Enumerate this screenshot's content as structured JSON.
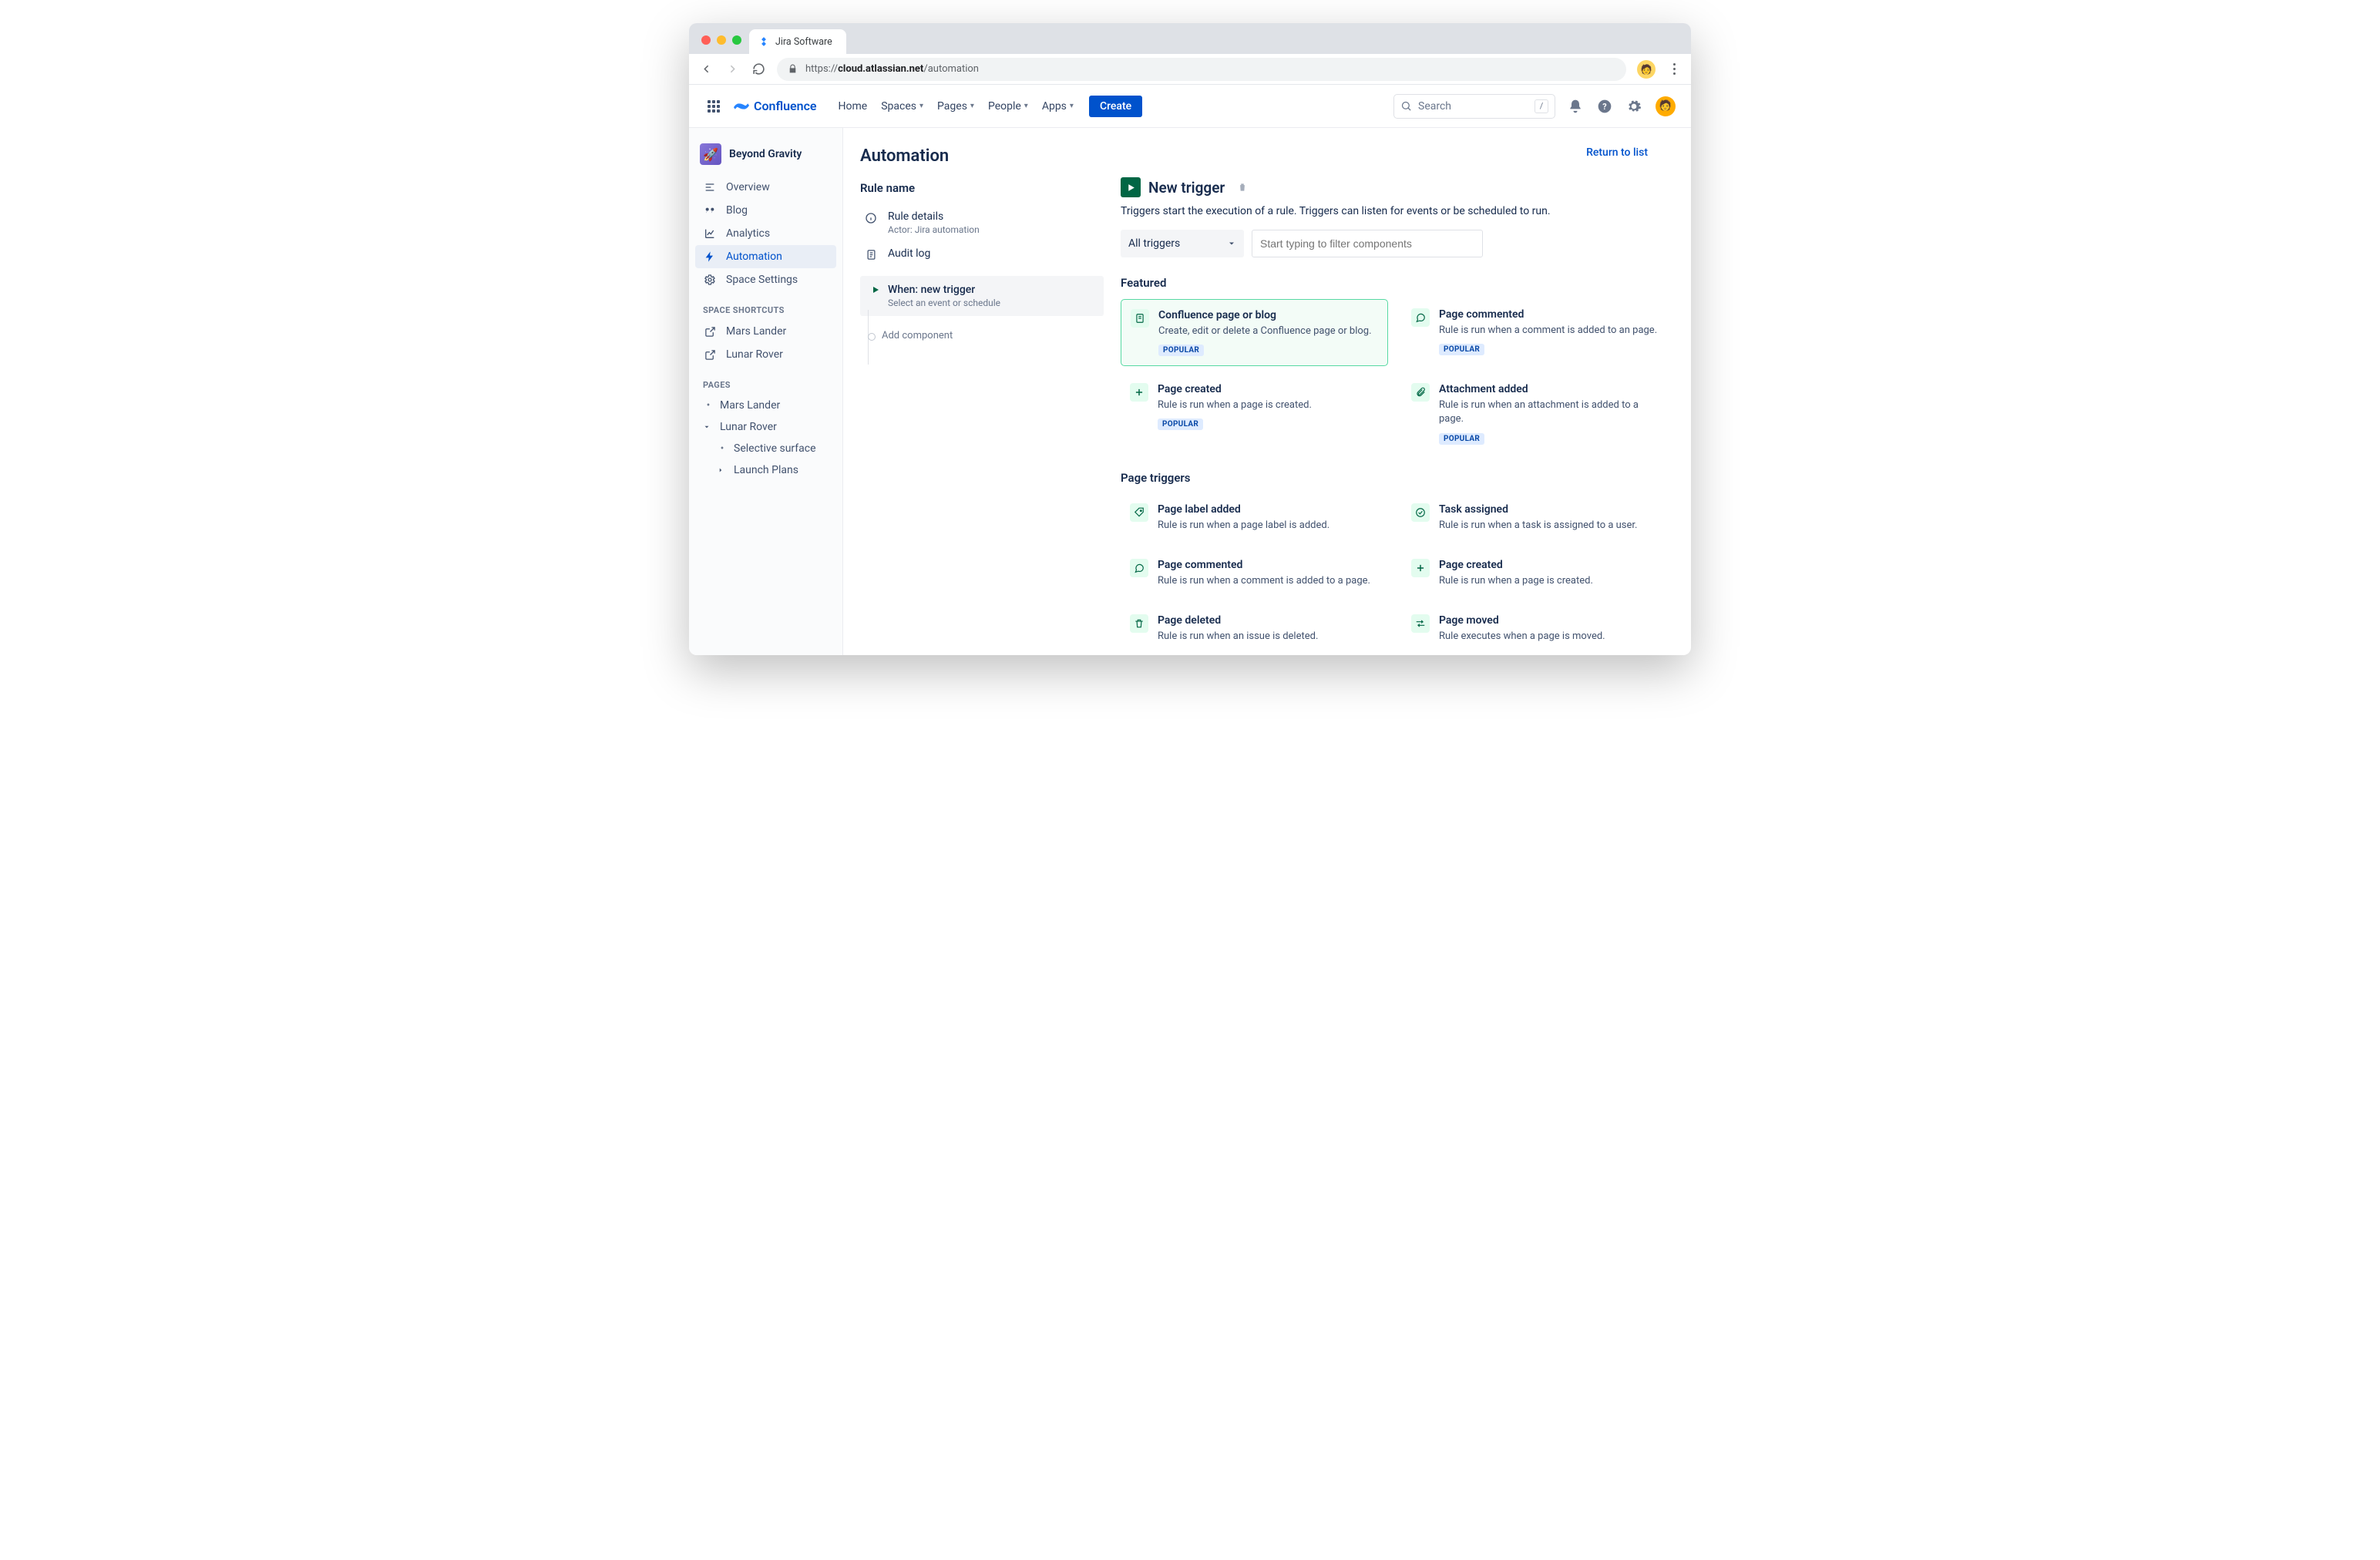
{
  "browser": {
    "tab_title": "Jira Software",
    "url_prefix": "https://",
    "url_host": "cloud.atlassian.net",
    "url_path": "/automation"
  },
  "header": {
    "product": "Confluence",
    "nav": [
      "Home",
      "Spaces",
      "Pages",
      "People",
      "Apps"
    ],
    "nav_has_caret": [
      false,
      true,
      true,
      true,
      true
    ],
    "create": "Create",
    "search_placeholder": "Search",
    "search_key": "/"
  },
  "sidebar": {
    "space_name": "Beyond Gravity",
    "items": [
      {
        "icon": "overview",
        "label": "Overview"
      },
      {
        "icon": "blog",
        "label": "Blog"
      },
      {
        "icon": "analytics",
        "label": "Analytics"
      },
      {
        "icon": "automation",
        "label": "Automation",
        "active": true
      },
      {
        "icon": "settings",
        "label": "Space Settings"
      }
    ],
    "shortcuts_heading": "SPACE SHORTCUTS",
    "shortcuts": [
      {
        "label": "Mars Lander"
      },
      {
        "label": "Lunar Rover"
      }
    ],
    "pages_heading": "PAGES",
    "pages": [
      {
        "kind": "leaf",
        "label": "Mars Lander"
      },
      {
        "kind": "open",
        "label": "Lunar Rover"
      },
      {
        "kind": "child-leaf",
        "label": "Selective surface"
      },
      {
        "kind": "child-closed",
        "label": "Launch Plans"
      }
    ]
  },
  "page": {
    "title": "Automation",
    "return": "Return to list"
  },
  "rule": {
    "section": "Rule name",
    "details_label": "Rule details",
    "details_sub": "Actor: Jira automation",
    "audit_label": "Audit log",
    "step_title": "When: new trigger",
    "step_sub": "Select an event or schedule",
    "add": "Add component"
  },
  "trigger": {
    "title": "New trigger",
    "desc": "Triggers start the execution of a rule. Triggers can listen for events or be scheduled to run.",
    "dropdown": "All triggers",
    "filter_placeholder": "Start typing to filter components",
    "featured_heading": "Featured",
    "featured": [
      {
        "icon": "page",
        "title": "Confluence page or blog",
        "desc": "Create, edit or delete a Confluence page or blog.",
        "popular": true,
        "highlight": true
      },
      {
        "icon": "comment",
        "title": "Page commented",
        "desc": "Rule is run when a comment is added to an page.",
        "popular": true
      },
      {
        "icon": "plus",
        "title": "Page created",
        "desc": "Rule is run when a page is created.",
        "popular": true
      },
      {
        "icon": "attach",
        "title": "Attachment added",
        "desc": "Rule is run when an attachment is added to a page.",
        "popular": true
      }
    ],
    "page_heading": "Page triggers",
    "page_triggers": [
      {
        "icon": "tag",
        "title": "Page label added",
        "desc": "Rule is run when a page label is added."
      },
      {
        "icon": "task",
        "title": "Task assigned",
        "desc": "Rule is run when a task is assigned to a user."
      },
      {
        "icon": "comment",
        "title": "Page commented",
        "desc": "Rule is run when a comment is added to a page."
      },
      {
        "icon": "plus",
        "title": "Page created",
        "desc": "Rule is run when a page is created."
      },
      {
        "icon": "trash",
        "title": "Page deleted",
        "desc": "Rule is run when an issue is deleted."
      },
      {
        "icon": "move",
        "title": "Page moved",
        "desc": "Rule executes when a page is moved."
      }
    ],
    "popular_tag": "POPULAR"
  }
}
